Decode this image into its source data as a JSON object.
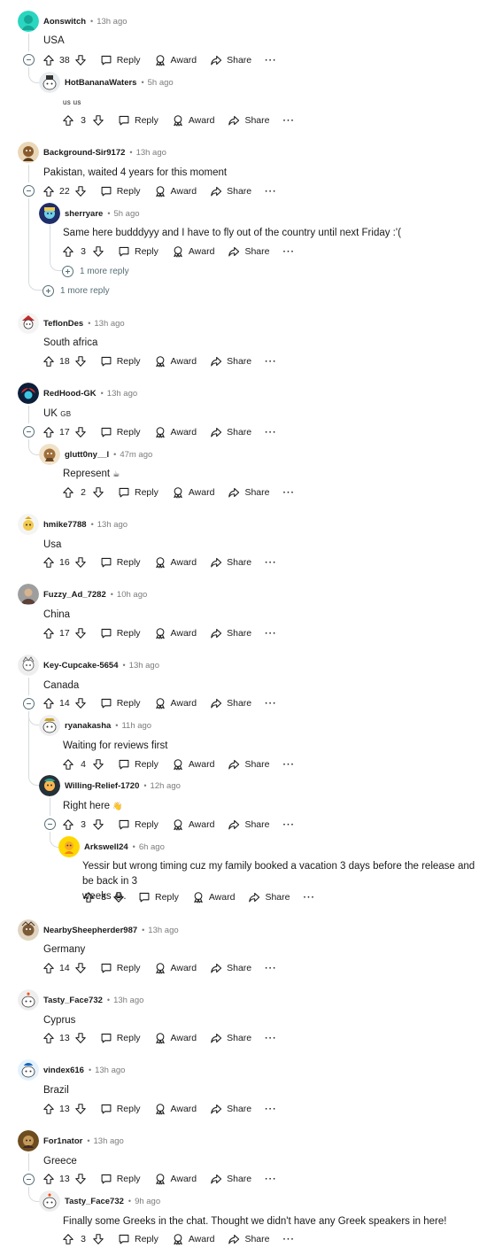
{
  "actions": {
    "reply": "Reply",
    "award": "Award",
    "share": "Share",
    "more": "···"
  },
  "comments": {
    "c1": {
      "user": "Aonswitch",
      "time": "13h ago",
      "text": "USA",
      "score": "38"
    },
    "c1r": {
      "user": "HotBananaWaters",
      "time": "5h ago",
      "text": "us us",
      "score": "3"
    },
    "c2": {
      "user": "Background-Sir9172",
      "time": "13h ago",
      "text": "Pakistan, waited 4 years for this moment",
      "score": "22"
    },
    "c2r": {
      "user": "sherryare",
      "time": "5h ago",
      "text": "Same here budddyyy and I have to fly out of the country until next Friday :'(",
      "score": "3"
    },
    "c3": {
      "user": "TeflonDes",
      "time": "13h ago",
      "text": "South africa",
      "score": "18"
    },
    "c4": {
      "user": "RedHood-GK",
      "time": "13h ago",
      "text": "UK",
      "flag": "GB",
      "score": "17"
    },
    "c4r": {
      "user": "glutt0ny__l",
      "time": "47m ago",
      "text": "Represent",
      "emoji": "☕",
      "score": "2"
    },
    "c5": {
      "user": "hmike7788",
      "time": "13h ago",
      "text": "Usa",
      "score": "16"
    },
    "c6": {
      "user": "Fuzzy_Ad_7282",
      "time": "10h ago",
      "text": "China",
      "score": "17"
    },
    "c7": {
      "user": "Key-Cupcake-5654",
      "time": "13h ago",
      "text": "Canada",
      "score": "14"
    },
    "c7r1": {
      "user": "ryanakasha",
      "time": "11h ago",
      "text": "Waiting for reviews first",
      "score": "4"
    },
    "c7r2": {
      "user": "Willing-Relief-1720",
      "time": "12h ago",
      "text": "Right here",
      "emoji": "👋",
      "score": "3"
    },
    "c7r2r": {
      "user": "Arkswell24",
      "time": "6h ago",
      "text1": "Yessir but wrong timing cuz my family booked a vacation 3 days before the release and be back in 3",
      "text2": "weeks",
      "emoji": "😭",
      "score": "3"
    },
    "c8": {
      "user": "NearbySheepherder987",
      "time": "13h ago",
      "text": "Germany",
      "score": "14"
    },
    "c9": {
      "user": "Tasty_Face732",
      "time": "13h ago",
      "text": "Cyprus",
      "score": "13"
    },
    "c10": {
      "user": "vindex616",
      "time": "13h ago",
      "text": "Brazil",
      "score": "13"
    },
    "c11": {
      "user": "For1nator",
      "time": "13h ago",
      "text": "Greece",
      "score": "13"
    },
    "c11r": {
      "user": "Tasty_Face732",
      "time": "9h ago",
      "text": "Finally some Greeks in the chat. Thought we didn't have any Greek speakers in here!",
      "score": "3"
    }
  },
  "more_replies": {
    "m1": "1 more reply",
    "m2": "1 more reply"
  },
  "icons": {
    "upvote": "upvote-arrow-icon",
    "downvote": "downvote-arrow-icon",
    "reply": "speech-bubble-icon",
    "award": "award-ribbon-icon",
    "share": "share-arrow-icon"
  },
  "colors": {
    "text": "#1a1a1b",
    "meta": "#7c7c7c",
    "thread_line": "#d7dadc",
    "icon": "#576f76"
  }
}
